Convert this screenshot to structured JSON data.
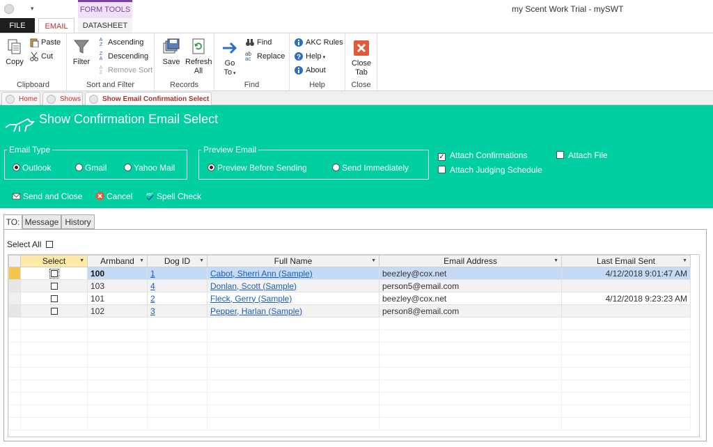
{
  "window": {
    "title": "my Scent Work Trial - mySWT",
    "context_tab": "FORM TOOLS"
  },
  "ribbon_tabs": {
    "file": "FILE",
    "email": "EMAIL",
    "datasheet": "DATASHEET"
  },
  "ribbon": {
    "clipboard": {
      "label": "Clipboard",
      "copy": "Copy",
      "paste": "Paste",
      "cut": "Cut"
    },
    "sort_filter": {
      "label": "Sort and Filter",
      "filter": "Filter",
      "ascending": "Ascending",
      "descending": "Descending",
      "remove_sort": "Remove Sort"
    },
    "records": {
      "label": "Records",
      "save": "Save",
      "refresh_1": "Refresh",
      "refresh_2": "All"
    },
    "find": {
      "label": "Find",
      "goto_1": "Go",
      "goto_2": "To",
      "find": "Find",
      "replace": "Replace"
    },
    "help": {
      "label": "Help",
      "akc_rules": "AKC Rules",
      "help": "Help",
      "about": "About"
    },
    "close": {
      "label": "Close",
      "close_1": "Close",
      "close_2": "Tab"
    }
  },
  "doc_tabs": [
    "Home",
    "Shows",
    "Show Email Confirmation Select"
  ],
  "header": {
    "title": "Show Confirmation Email Select"
  },
  "email_type": {
    "legend": "Email Type",
    "options": [
      "Outlook",
      "Gmail",
      "Yahoo Mail"
    ],
    "selected": "Outlook"
  },
  "preview_email": {
    "legend": "Preview Email",
    "options": [
      "Preview Before Sending",
      "Send Immediately"
    ],
    "selected": "Preview Before Sending"
  },
  "attachments": {
    "confirmations": "Attach Confirmations",
    "judging": "Attach Judging Schedule",
    "file": "Attach File"
  },
  "actions": {
    "send": "Send and Close",
    "cancel": "Cancel",
    "spell": "Spell Check"
  },
  "content_tabs": [
    "TO:",
    "Message",
    "History"
  ],
  "select_all": "Select All",
  "grid": {
    "columns": [
      "Select",
      "Armband",
      "Dog ID",
      "Full Name",
      "Email Address",
      "Last Email Sent"
    ],
    "rows": [
      {
        "armband": "100",
        "dog_id": "1",
        "name": " Cabot, Sherri Ann (Sample)",
        "email": "beezley@cox.net",
        "last_sent": "4/12/2018 9:01:47 AM"
      },
      {
        "armband": "103",
        "dog_id": "4",
        "name": " Donlan, Scott (Sample)",
        "email": "person5@email.com",
        "last_sent": ""
      },
      {
        "armband": "101",
        "dog_id": "2",
        "name": " Fleck, Gerry (Sample)",
        "email": "beezley@cox.net",
        "last_sent": "4/12/2018 9:23:23 AM"
      },
      {
        "armband": "102",
        "dog_id": "3",
        "name": " Pepper, Harlan (Sample)",
        "email": "person8@email.com",
        "last_sent": ""
      }
    ]
  }
}
